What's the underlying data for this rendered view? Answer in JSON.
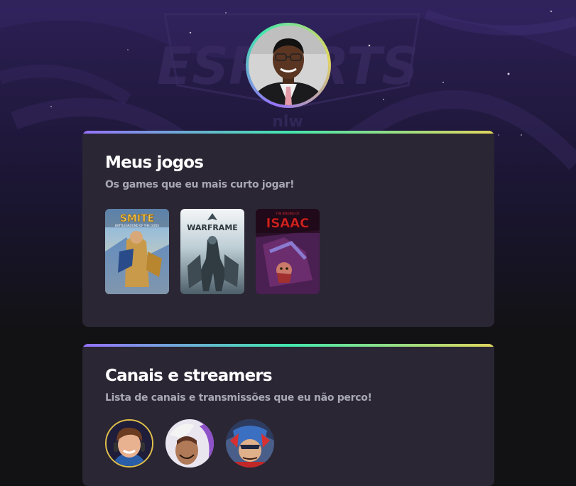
{
  "profile": {
    "avatar_alt": "Foto de perfil",
    "avatar_icon": "profile-photo",
    "ring_colors": [
      "#9572fc",
      "#43e7ad",
      "#e1d55d"
    ]
  },
  "background": {
    "logo_text": "ESPORTS",
    "logo_sub": "nlw"
  },
  "games_section": {
    "title": "Meus jogos",
    "subtitle": "Os games que eu mais curto jogar!",
    "games": [
      {
        "name": "SMITE",
        "tagline": "BATTLEGROUND OF THE GODS"
      },
      {
        "name": "WARFRAME"
      },
      {
        "name": "ISAAC",
        "tagline": "THE BINDING OF"
      }
    ]
  },
  "streamers_section": {
    "title": "Canais e streamers",
    "subtitle": "Lista de canais e transmissões que eu não perco!",
    "streamers": [
      {
        "icon": "streamer-avatar-1"
      },
      {
        "icon": "streamer-avatar-2"
      },
      {
        "icon": "streamer-avatar-3"
      }
    ]
  },
  "colors": {
    "card_bg": "#2a2634",
    "page_bg": "#121214",
    "accent_gradient": [
      "#9572fc",
      "#43e7ad",
      "#e1d55d"
    ],
    "title": "#ffffff",
    "subtitle": "#a8a8b3"
  }
}
